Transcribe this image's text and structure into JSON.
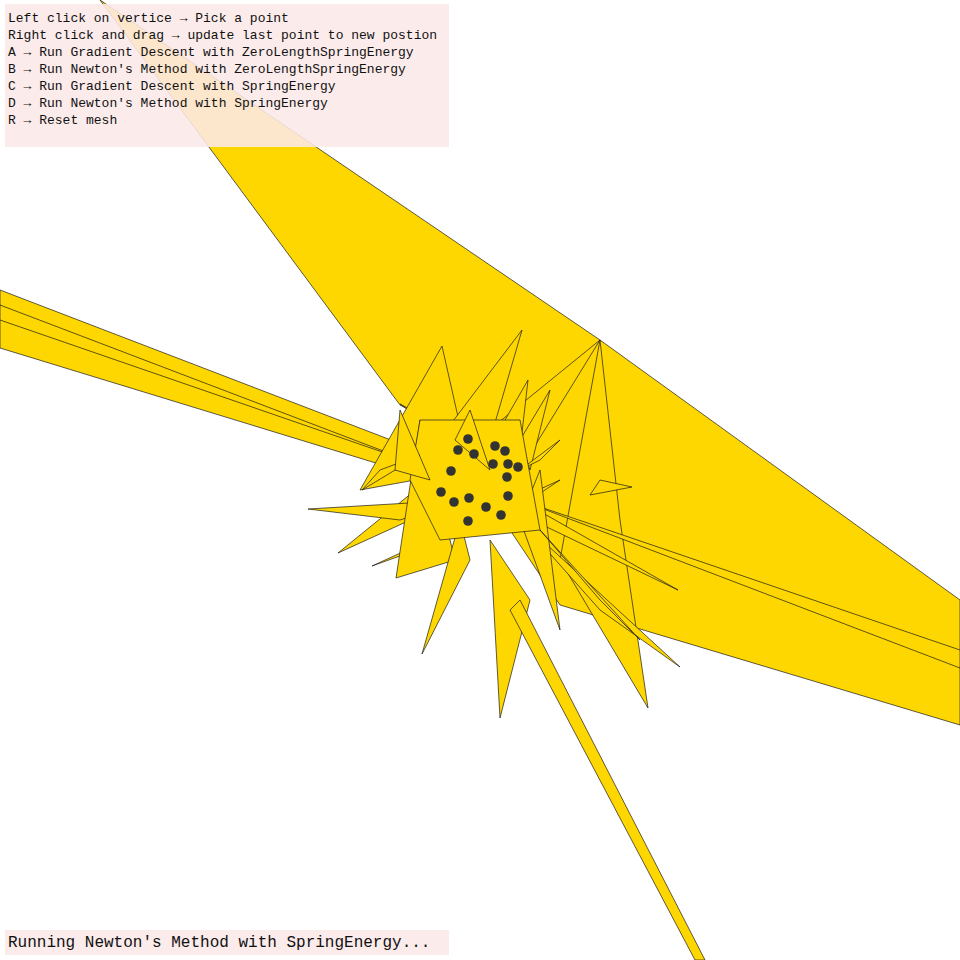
{
  "instructions": [
    "Left click on vertice → Pick a point",
    "Right click and drag → update last point to new postion",
    "A → Run Gradient Descent with ZeroLengthSpringEnergy",
    "B → Run Newton's Method with ZeroLengthSpringEnergy",
    "C → Run Gradient Descent with SpringEnergy",
    "D → Run Newton's Method with SpringEnergy",
    "R → Reset mesh"
  ],
  "status_bar": "Running Newton's Method with SpringEnergy..."
}
